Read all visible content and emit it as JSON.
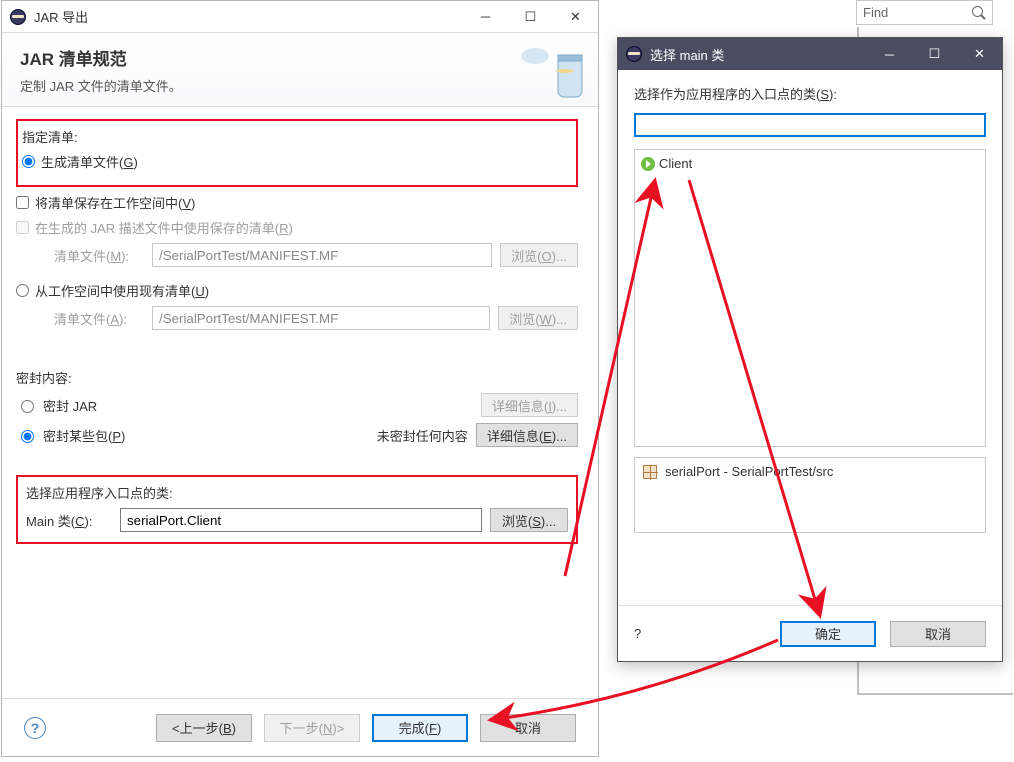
{
  "find": {
    "placeholder": "Find"
  },
  "jarDialog": {
    "title": "JAR 导出",
    "bannerTitle": "JAR 清单规范",
    "bannerSub": "定制 JAR 文件的清单文件。",
    "specifyLabel": "指定清单:",
    "genManifest": "生成清单文件(G)",
    "saveWorkspace": "将清单保存在工作空间中(V)",
    "useSaved": "在生成的 JAR 描述文件中使用保存的清单(R)",
    "manifestFile1Label": "清单文件(M):",
    "manifestFile1": "/SerialPortTest/MANIFEST.MF",
    "browse1": "浏览(O)...",
    "useExisting": "从工作空间中使用现有清单(U)",
    "manifestFile2Label": "清单文件(A):",
    "manifestFile2": "/SerialPortTest/MANIFEST.MF",
    "browse2": "浏览(W)...",
    "sealLabel": "密封内容:",
    "sealJar": "密封 JAR",
    "details1": "详细信息(I)...",
    "sealSome": "密封某些包(P)",
    "unsealed": "未密封任何内容",
    "details2": "详细信息(E)...",
    "entryLabel": "选择应用程序入口点的类:",
    "mainLabel": "Main 类(C):",
    "mainValue": "serialPort.Client",
    "browse3": "浏览(S)...",
    "back": "<上一步(B)",
    "next": "下一步(N)>",
    "finish": "完成(F)",
    "cancel": "取消"
  },
  "selectDialog": {
    "title": "选择 main 类",
    "prompt": "选择作为应用程序的入口点的类(S):",
    "item": "Client",
    "pkg": "serialPort - SerialPortTest/src",
    "ok": "确定",
    "cancel": "取消"
  }
}
